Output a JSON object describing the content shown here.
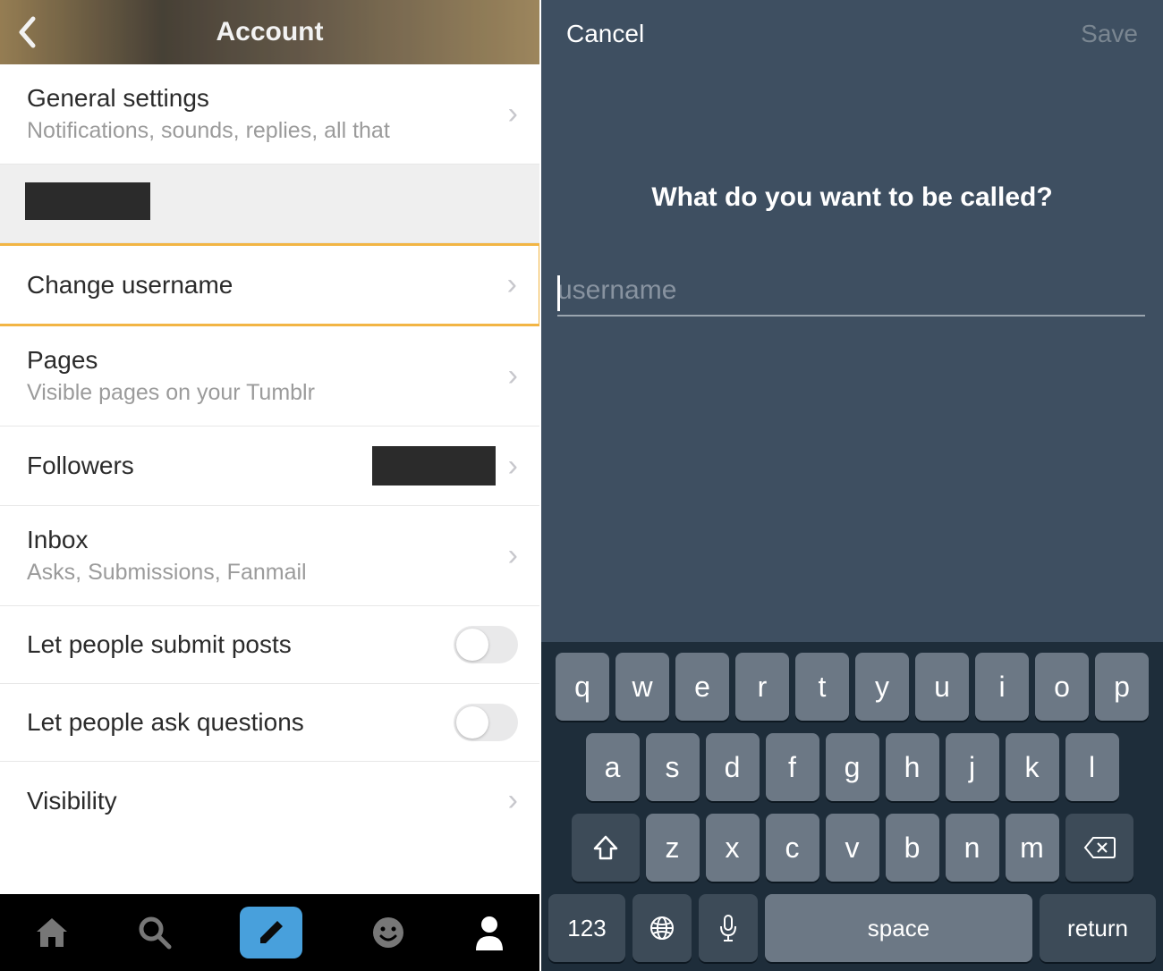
{
  "left": {
    "title": "Account",
    "rows": {
      "general": {
        "title": "General settings",
        "sub": "Notifications, sounds, replies, all that"
      },
      "change_username": {
        "title": "Change username"
      },
      "pages": {
        "title": "Pages",
        "sub": "Visible pages on your Tumblr"
      },
      "followers": {
        "title": "Followers"
      },
      "inbox": {
        "title": "Inbox",
        "sub": "Asks, Submissions, Fanmail"
      },
      "submit": {
        "title": "Let people submit posts"
      },
      "ask": {
        "title": "Let people ask questions"
      },
      "visibility": {
        "title": "Visibility"
      }
    }
  },
  "right": {
    "cancel": "Cancel",
    "save": "Save",
    "heading": "What do you want to be called?",
    "placeholder": "username",
    "value": ""
  },
  "keyboard": {
    "row1": [
      "q",
      "w",
      "e",
      "r",
      "t",
      "y",
      "u",
      "i",
      "o",
      "p"
    ],
    "row2": [
      "a",
      "s",
      "d",
      "f",
      "g",
      "h",
      "j",
      "k",
      "l"
    ],
    "row3": [
      "z",
      "x",
      "c",
      "v",
      "b",
      "n",
      "m"
    ],
    "num": "123",
    "space": "space",
    "return": "return"
  }
}
